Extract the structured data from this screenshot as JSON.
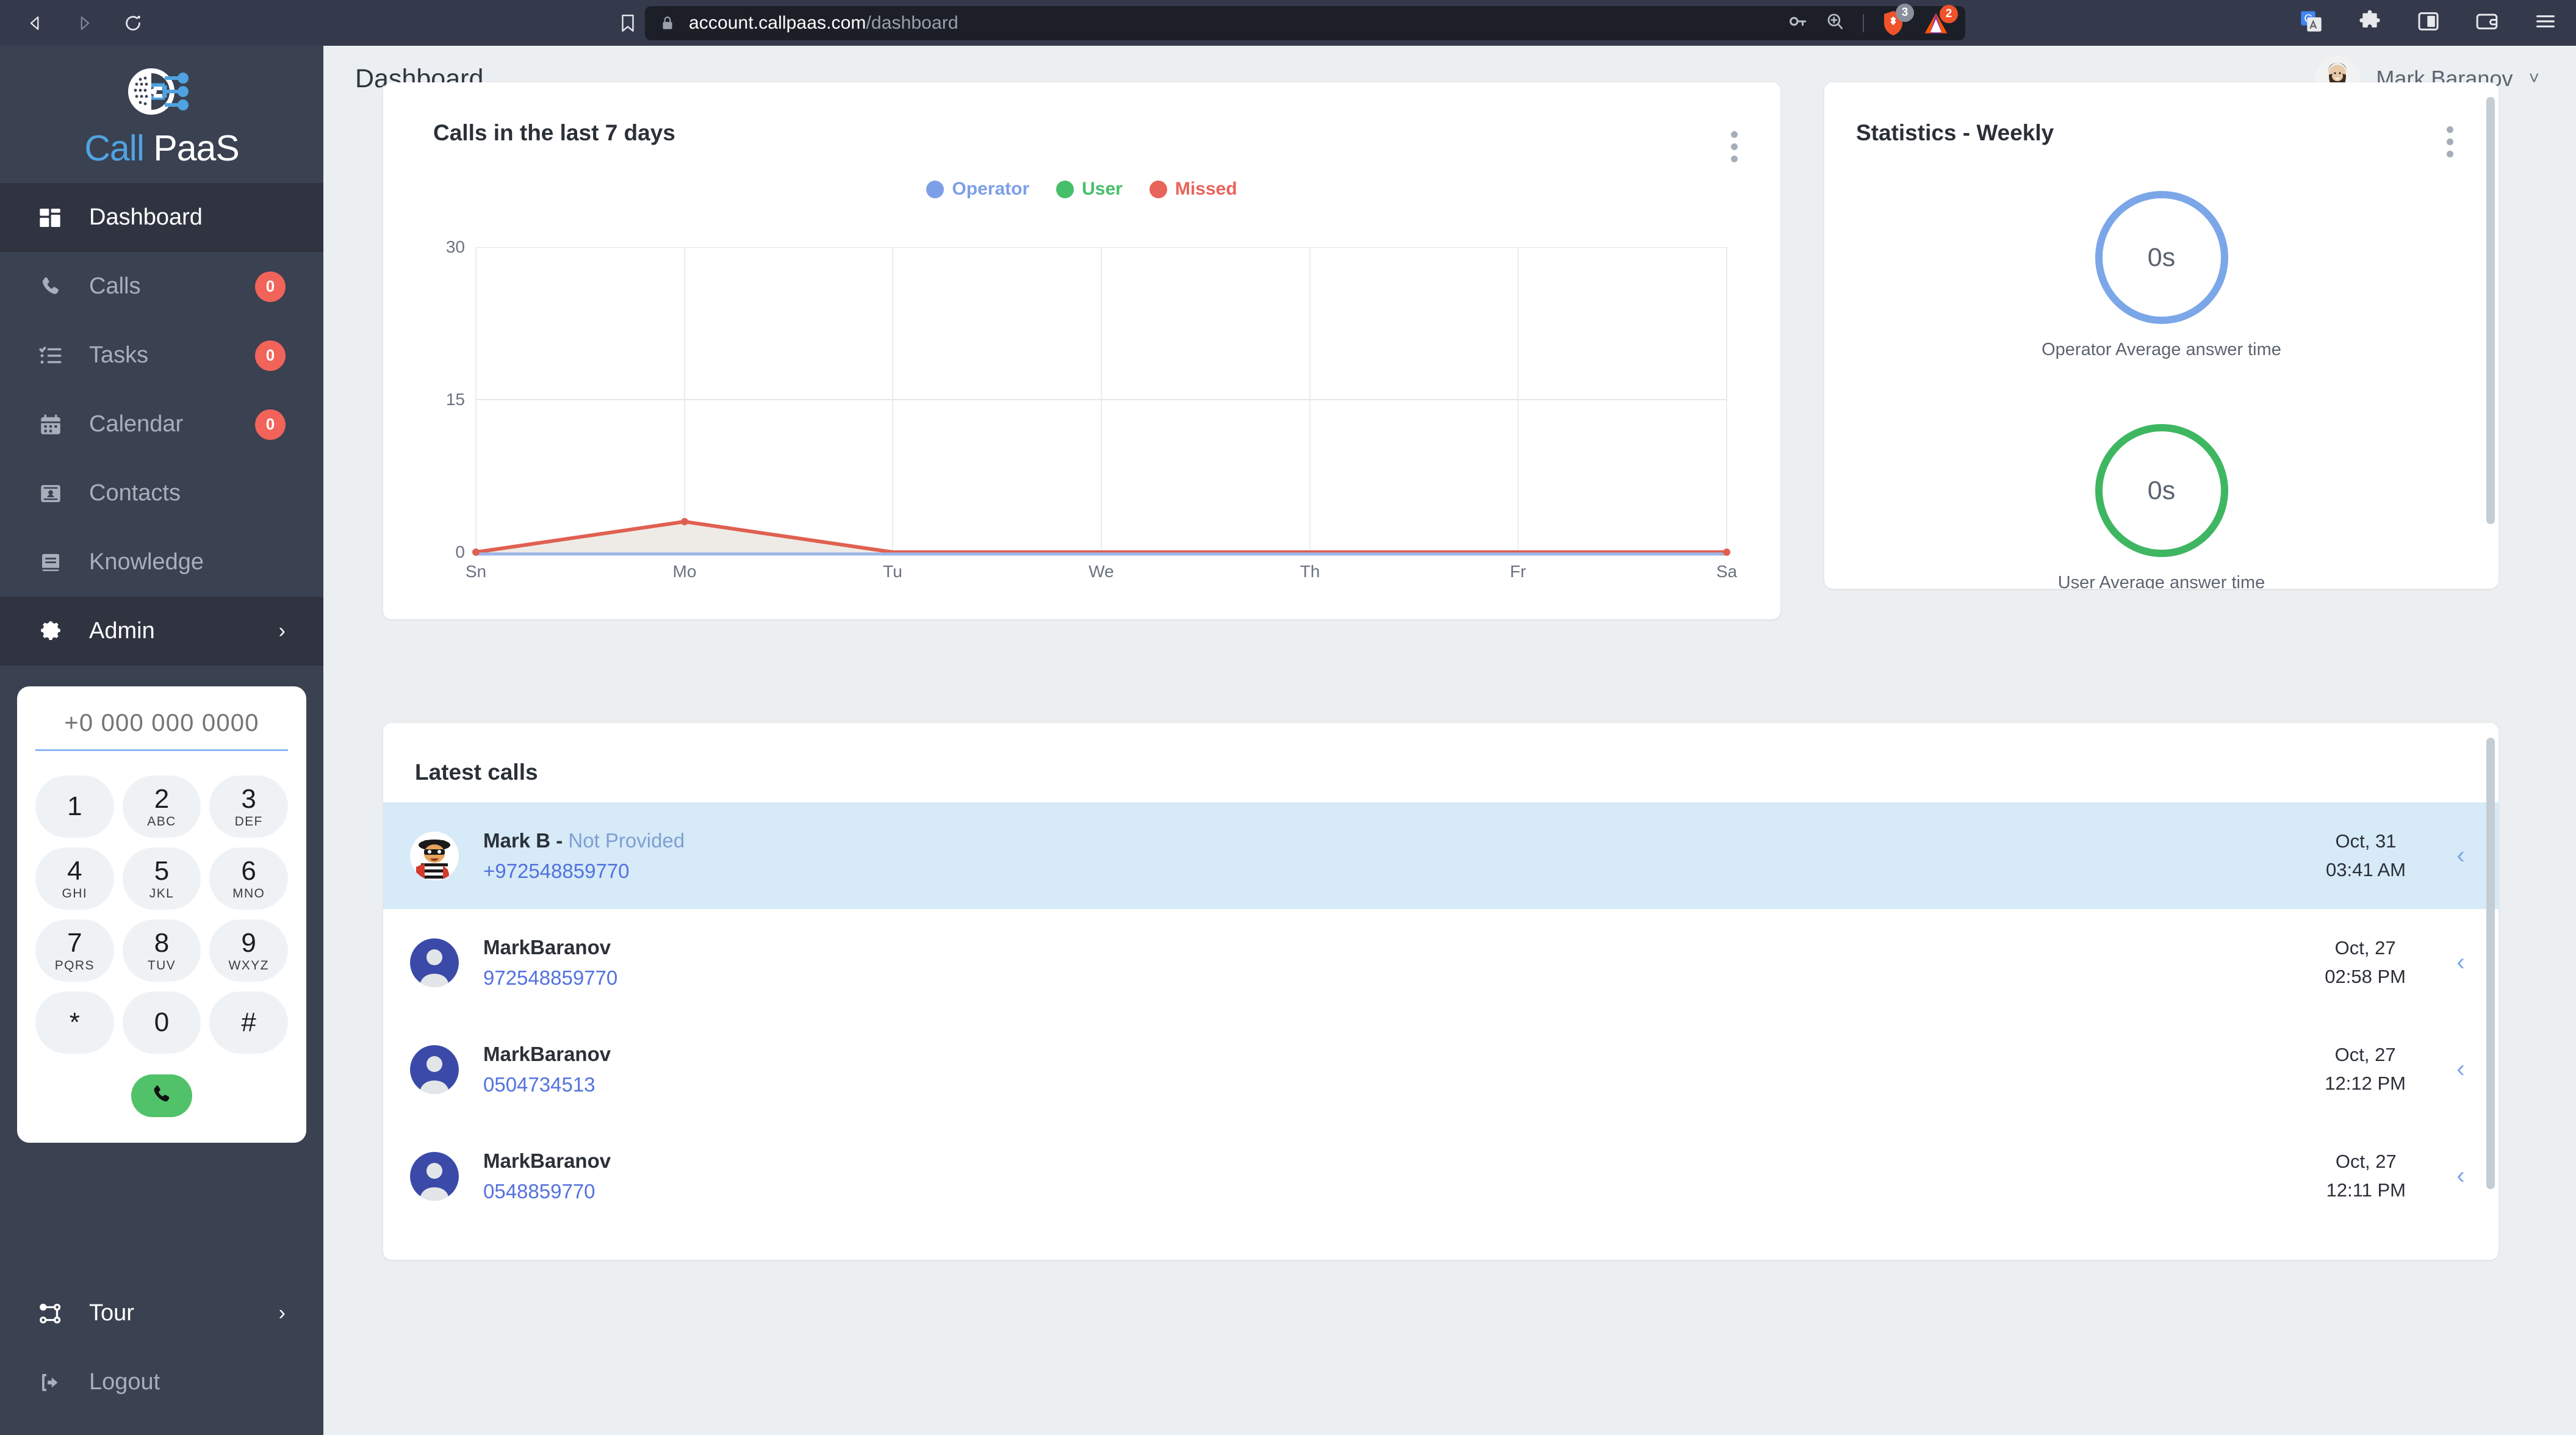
{
  "browser": {
    "back_icon": "back-arrow-icon",
    "forward_icon": "forward-arrow-icon",
    "reload_icon": "reload-icon",
    "bookmark_icon": "bookmark-icon",
    "lock_icon": "lock-icon",
    "url_host": "account.callpaas.com",
    "url_path": "/dashboard",
    "password_icon": "key-icon",
    "zoom_icon": "zoom-in-icon",
    "shields": {
      "icon": "brave-shields-lion-icon",
      "count": "3",
      "badge_color": "#8a8f9c"
    },
    "rewards": {
      "icon": "brave-rewards-triangle-icon",
      "count": "2",
      "badge_color": "#f0522a"
    },
    "right_icons": [
      {
        "icon": "google-translate-icon"
      },
      {
        "icon": "extensions-puzzle-icon"
      },
      {
        "icon": "sidebar-panel-icon"
      },
      {
        "icon": "brave-wallet-icon"
      },
      {
        "icon": "browser-menu-hamburger-icon"
      }
    ]
  },
  "sidebar": {
    "logo": {
      "mark_icon": "callpaas-logo-icon",
      "text_a": "Call ",
      "text_b": "PaaS"
    },
    "items": [
      {
        "label": "Dashboard",
        "icon": "dashboard-grid-icon",
        "active": true,
        "badge": null,
        "chevron": false
      },
      {
        "label": "Calls",
        "icon": "phone-icon",
        "active": false,
        "badge": "0",
        "chevron": false
      },
      {
        "label": "Tasks",
        "icon": "tasks-checklist-icon",
        "active": false,
        "badge": "0",
        "chevron": false
      },
      {
        "label": "Calendar",
        "icon": "calendar-icon",
        "active": false,
        "badge": "0",
        "chevron": false
      },
      {
        "label": "Contacts",
        "icon": "contacts-card-icon",
        "active": false,
        "badge": null,
        "chevron": false
      },
      {
        "label": "Knowledge",
        "icon": "book-icon",
        "active": false,
        "badge": null,
        "chevron": false
      },
      {
        "label": "Admin",
        "icon": "gear-icon",
        "active": true,
        "badge": null,
        "chevron": true
      }
    ],
    "bottom_items": [
      {
        "label": "Tour",
        "icon": "tour-nodes-icon",
        "chevron": true
      },
      {
        "label": "Logout",
        "icon": "logout-icon",
        "chevron": false
      }
    ],
    "badge_color": "#f2635a"
  },
  "dialpad": {
    "input_value": "",
    "input_placeholder": "+0 000 000 0000",
    "keys": [
      {
        "num": "1",
        "letters": ""
      },
      {
        "num": "2",
        "letters": "ABC"
      },
      {
        "num": "3",
        "letters": "DEF"
      },
      {
        "num": "4",
        "letters": "GHI"
      },
      {
        "num": "5",
        "letters": "JKL"
      },
      {
        "num": "6",
        "letters": "MNO"
      },
      {
        "num": "7",
        "letters": "PQRS"
      },
      {
        "num": "8",
        "letters": "TUV"
      },
      {
        "num": "9",
        "letters": "WXYZ"
      },
      {
        "num": "*",
        "letters": ""
      },
      {
        "num": "0",
        "letters": ""
      },
      {
        "num": "#",
        "letters": ""
      }
    ],
    "call_button_icon": "phone-call-icon",
    "call_button_color": "#52c26a"
  },
  "header": {
    "title": "Dashboard",
    "user_name": "Mark Baranov",
    "avatar_icon": "user-photo-avatar",
    "caret_icon": "chevron-down-icon"
  },
  "chart_card": {
    "title": "Calls in the last 7 days",
    "kebab_icon": "more-vertical-icon"
  },
  "chart_data": {
    "type": "line",
    "title": "Calls in the last 7 days",
    "categories": [
      "Sn",
      "Mo",
      "Tu",
      "We",
      "Th",
      "Fr",
      "Sa"
    ],
    "series": [
      {
        "name": "Operator",
        "color": "#7d9fe8",
        "values": [
          0,
          0,
          0,
          0,
          0,
          0,
          0
        ]
      },
      {
        "name": "User",
        "color": "#45bf69",
        "values": [
          0,
          0,
          0,
          0,
          0,
          0,
          0
        ]
      },
      {
        "name": "Missed",
        "color": "#e8635a",
        "values": [
          0,
          3,
          0,
          0,
          0,
          0,
          0
        ]
      }
    ],
    "ylim": [
      0,
      30
    ],
    "yticks": [
      0,
      15,
      30
    ],
    "xlabel": "",
    "ylabel": "",
    "grid": true,
    "legend_position": "top-center",
    "area_fill": true
  },
  "stats_card": {
    "title": "Statistics - Weekly",
    "kebab_icon": "more-vertical-icon",
    "rings": [
      {
        "value": "0s",
        "caption": "Operator Average answer time",
        "color": "#7ba7e8"
      },
      {
        "value": "0s",
        "caption": "User Average answer time",
        "color": "#3fb661"
      }
    ]
  },
  "calls_card": {
    "title": "Latest calls",
    "rows": [
      {
        "name": "Mark B - ",
        "name_suffix": "Not Provided",
        "number": "+972548859770",
        "date": "Oct, 31",
        "time": "03:41 AM",
        "selected": true,
        "avatar_icon": "hamburglar-cartoon-avatar",
        "arrow_icon": "chevron-left-icon"
      },
      {
        "name": "MarkBaranov",
        "name_suffix": "",
        "number": "972548859770",
        "date": "Oct, 27",
        "time": "02:58 PM",
        "selected": false,
        "avatar_icon": "default-person-avatar",
        "arrow_icon": "chevron-left-icon"
      },
      {
        "name": "MarkBaranov",
        "name_suffix": "",
        "number": "0504734513",
        "date": "Oct, 27",
        "time": "12:12 PM",
        "selected": false,
        "avatar_icon": "default-person-avatar",
        "arrow_icon": "chevron-left-icon"
      },
      {
        "name": "MarkBaranov",
        "name_suffix": "",
        "number": "0548859770",
        "date": "Oct, 27",
        "time": "12:11 PM",
        "selected": false,
        "avatar_icon": "default-person-avatar",
        "arrow_icon": "chevron-left-icon"
      }
    ]
  }
}
